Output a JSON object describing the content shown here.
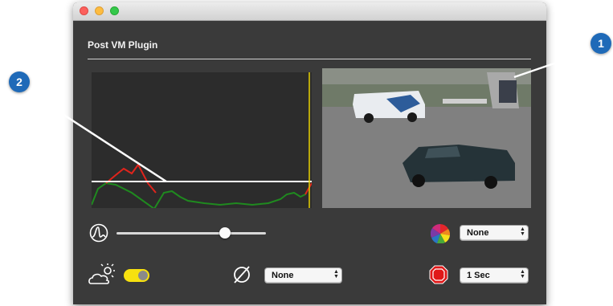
{
  "window": {
    "plugin_title": "Post VM Plugin"
  },
  "callouts": [
    "1",
    "2"
  ],
  "controls": {
    "color_filter": {
      "icon": "color-wheel-icon",
      "value": "None"
    },
    "overlay": {
      "icon": "empty-set-icon",
      "value": "None"
    },
    "hold_time": {
      "icon": "stop-sign-icon",
      "value": "1 Sec"
    },
    "weather_toggle": {
      "icon": "weather-icon",
      "state": "on"
    },
    "sensitivity_slider": {
      "icon": "waveform-icon",
      "level": 0.73
    }
  },
  "graph": {
    "threshold_level": 0.79,
    "colors": {
      "above": "#e0241c",
      "below": "#1f8a1f",
      "threshold": "#ffffff",
      "marker": "#e6d200"
    }
  },
  "colors": {
    "accent_callout": "#1f6ab8",
    "toggle_on": "#f7e10f"
  }
}
